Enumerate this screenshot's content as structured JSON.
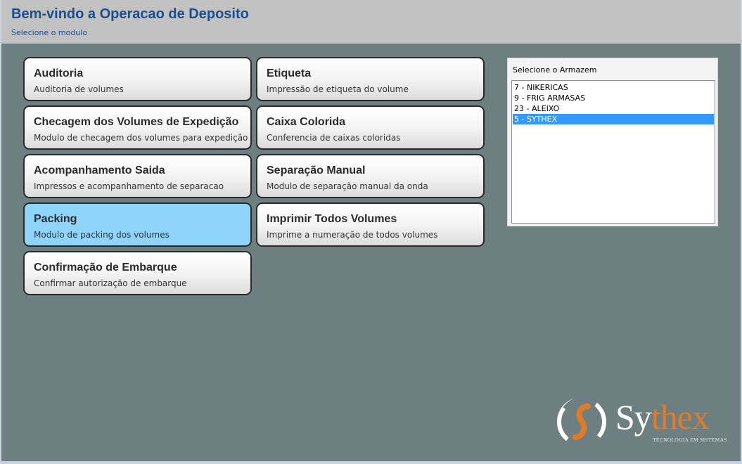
{
  "header": {
    "title": "Bem-vindo a Operacao de Deposito",
    "subtitle": "Selecione o modulo"
  },
  "modules": [
    {
      "title": "Auditoria",
      "description": "Auditoria de volumes"
    },
    {
      "title": "Etiqueta",
      "description": "Impressão de etiqueta do volume"
    },
    {
      "title": "Checagem dos Volumes de Expedição",
      "description": "Modulo de checagem dos volumes para expedição"
    },
    {
      "title": "Caixa Colorida",
      "description": "Conferencia de caixas coloridas"
    },
    {
      "title": "Acompanhamento Saida",
      "description": "Impressos e acompanhamento de separacao"
    },
    {
      "title": "Separação Manual",
      "description": "Modulo de separação manual da onda"
    },
    {
      "title": "Packing",
      "description": "Modulo de packing dos volumes"
    },
    {
      "title": "Imprimir Todos Volumes",
      "description": "Imprime a numeração de todos volumes"
    },
    {
      "title": "Confirmação de Embarque",
      "description": "Confirmar autorização de embarque"
    }
  ],
  "active_module": "Packing",
  "warehouse": {
    "label": "Selecione o Armazem",
    "items": [
      "7 - NIKERICAS",
      "9 - FRIG ARMASAS",
      "23 - ALEIXO",
      "5 - SYTHEX"
    ],
    "selected": "5 - SYTHEX"
  },
  "logo": {
    "name_main": "Sy",
    "name_accent": "thex",
    "tagline": "TECNOLOGIA EM SISTEMAS"
  },
  "colors": {
    "background": "#6e7f82",
    "header": "#c2c2c2",
    "title": "#1a4f96",
    "active_tile": "#8fd4fb",
    "selection": "#3399ff",
    "logo_accent": "#e07b2a"
  }
}
